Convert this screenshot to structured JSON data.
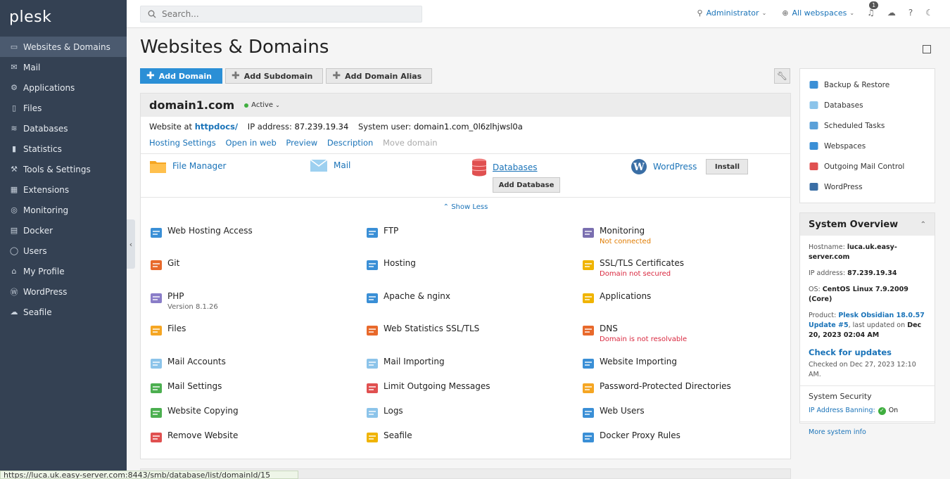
{
  "brand": "plesk",
  "nav": [
    {
      "label": "Websites & Domains",
      "icon": "monitor-icon",
      "glyph": "▭",
      "active": true
    },
    {
      "label": "Mail",
      "icon": "mail-icon",
      "glyph": "✉"
    },
    {
      "label": "Applications",
      "icon": "gear-icon",
      "glyph": "⚙"
    },
    {
      "label": "Files",
      "icon": "file-icon",
      "glyph": "▯"
    },
    {
      "label": "Databases",
      "icon": "layers-icon",
      "glyph": "≋"
    },
    {
      "label": "Statistics",
      "icon": "bar-chart-icon",
      "glyph": "▮"
    },
    {
      "label": "Tools & Settings",
      "icon": "sliders-icon",
      "glyph": "⚒"
    },
    {
      "label": "Extensions",
      "icon": "grid-icon",
      "glyph": "▦"
    },
    {
      "label": "Monitoring",
      "icon": "search-monitor-icon",
      "glyph": "◎"
    },
    {
      "label": "Docker",
      "icon": "docker-icon",
      "glyph": "▤"
    },
    {
      "label": "Users",
      "icon": "user-icon",
      "glyph": "◯"
    },
    {
      "label": "My Profile",
      "icon": "profile-icon",
      "glyph": "⌂"
    },
    {
      "label": "WordPress",
      "icon": "wordpress-icon",
      "glyph": "Ⓦ"
    },
    {
      "label": "Seafile",
      "icon": "seafile-icon",
      "glyph": "☁"
    }
  ],
  "search": {
    "placeholder": "Search..."
  },
  "topbar": {
    "user": "Administrator",
    "webspaces": "All webspaces",
    "notifications": "1"
  },
  "page": {
    "title": "Websites & Domains"
  },
  "toolbar": {
    "add_domain": "Add Domain",
    "add_subdomain": "Add Subdomain",
    "add_alias": "Add Domain Alias"
  },
  "domain": {
    "name": "domain1.com",
    "status": "Active",
    "website_at_label": "Website at",
    "website_at": "httpdocs/",
    "ip_label": "IP address:",
    "ip": "87.239.19.34",
    "sysuser_label": "System user:",
    "sysuser": "domain1.com_0l6zlhjwsl0a",
    "links": [
      "Hosting Settings",
      "Open in web",
      "Preview",
      "Description"
    ],
    "link_disabled": "Move domain",
    "quick": {
      "file_manager": "File Manager",
      "mail": "Mail",
      "databases": "Databases",
      "add_database": "Add Database",
      "wordpress": "WordPress",
      "install": "Install"
    },
    "show_less": "Show Less"
  },
  "tools": [
    {
      "label": "Web Hosting Access",
      "icon": "globe-user-icon",
      "color": "#3a8fd6"
    },
    {
      "label": "FTP",
      "icon": "ftp-icon",
      "color": "#3a8fd6"
    },
    {
      "label": "Monitoring",
      "icon": "monitoring-icon",
      "color": "#7a6fb0",
      "sub": "Not connected",
      "sub_type": "warn"
    },
    {
      "label": "Git",
      "icon": "git-icon",
      "color": "#e8692b"
    },
    {
      "label": "Hosting",
      "icon": "hosting-icon",
      "color": "#3a8fd6"
    },
    {
      "label": "SSL/TLS Certificates",
      "icon": "lock-icon",
      "color": "#f0b400",
      "sub": "Domain not secured",
      "sub_type": "err"
    },
    {
      "label": "PHP",
      "icon": "php-icon",
      "color": "#8a7dc8",
      "sub": "Version 8.1.26",
      "sub_type": ""
    },
    {
      "label": "Apache & nginx",
      "icon": "apache-icon",
      "color": "#3a8fd6"
    },
    {
      "label": "Applications",
      "icon": "gear-app-icon",
      "color": "#f0b400"
    },
    {
      "label": "Files",
      "icon": "folder-icon",
      "color": "#f5a623"
    },
    {
      "label": "Web Statistics SSL/TLS",
      "icon": "stats-icon",
      "color": "#e8692b"
    },
    {
      "label": "DNS",
      "icon": "dns-icon",
      "color": "#e8692b",
      "sub": "Domain is not resolvable",
      "sub_type": "err"
    },
    {
      "label": "Mail Accounts",
      "icon": "mail-accounts-icon",
      "color": "#8cc4ea"
    },
    {
      "label": "Mail Importing",
      "icon": "mail-import-icon",
      "color": "#8cc4ea"
    },
    {
      "label": "Website Importing",
      "icon": "website-import-icon",
      "color": "#3a8fd6"
    },
    {
      "label": "Mail Settings",
      "icon": "mail-settings-icon",
      "color": "#4caf50"
    },
    {
      "label": "Limit Outgoing Messages",
      "icon": "limit-mail-icon",
      "color": "#e05050"
    },
    {
      "label": "Password-Protected Directories",
      "icon": "protected-dir-icon",
      "color": "#f5a623"
    },
    {
      "label": "Website Copying",
      "icon": "copy-icon",
      "color": "#4caf50"
    },
    {
      "label": "Logs",
      "icon": "logs-icon",
      "color": "#8cc4ea"
    },
    {
      "label": "Web Users",
      "icon": "web-users-icon",
      "color": "#3a8fd6"
    },
    {
      "label": "Remove Website",
      "icon": "remove-icon",
      "color": "#e05050"
    },
    {
      "label": "Seafile",
      "icon": "seafile-tool-icon",
      "color": "#f0b400"
    },
    {
      "label": "Docker Proxy Rules",
      "icon": "docker-proxy-icon",
      "color": "#3a8fd6"
    }
  ],
  "right_links": [
    {
      "label": "Backup & Restore",
      "icon": "backup-icon",
      "color": "#3a8fd6"
    },
    {
      "label": "Databases",
      "icon": "database-icon",
      "color": "#8cc4ea"
    },
    {
      "label": "Scheduled Tasks",
      "icon": "calendar-icon",
      "color": "#5aa0d8"
    },
    {
      "label": "Webspaces",
      "icon": "webspaces-icon",
      "color": "#3a8fd6"
    },
    {
      "label": "Outgoing Mail Control",
      "icon": "outgoing-mail-icon",
      "color": "#e05050"
    },
    {
      "label": "WordPress",
      "icon": "wordpress-small-icon",
      "color": "#3a6ea5"
    }
  ],
  "overview": {
    "title": "System Overview",
    "hostname_label": "Hostname:",
    "hostname": "luca.uk.easy-server.com",
    "ip_label": "IP address:",
    "ip": "87.239.19.34",
    "os_label": "OS:",
    "os": "CentOS Linux 7.9.2009 (Core)",
    "product_label": "Product:",
    "product": "Plesk Obsidian 18.0.57 Update #5",
    "last_updated_text": ", last updated on",
    "last_updated": "Dec 20, 2023 02:04 AM",
    "check_updates": "Check for updates",
    "checked_on": "Checked on Dec 27, 2023 12:10 AM.",
    "security_title": "System Security",
    "ip_banning": "IP Address Banning:",
    "ip_banning_state": "On",
    "more_info": "More system info"
  },
  "status_url": "https://luca.uk.easy-server.com:8443/smb/database/list/domainId/15"
}
